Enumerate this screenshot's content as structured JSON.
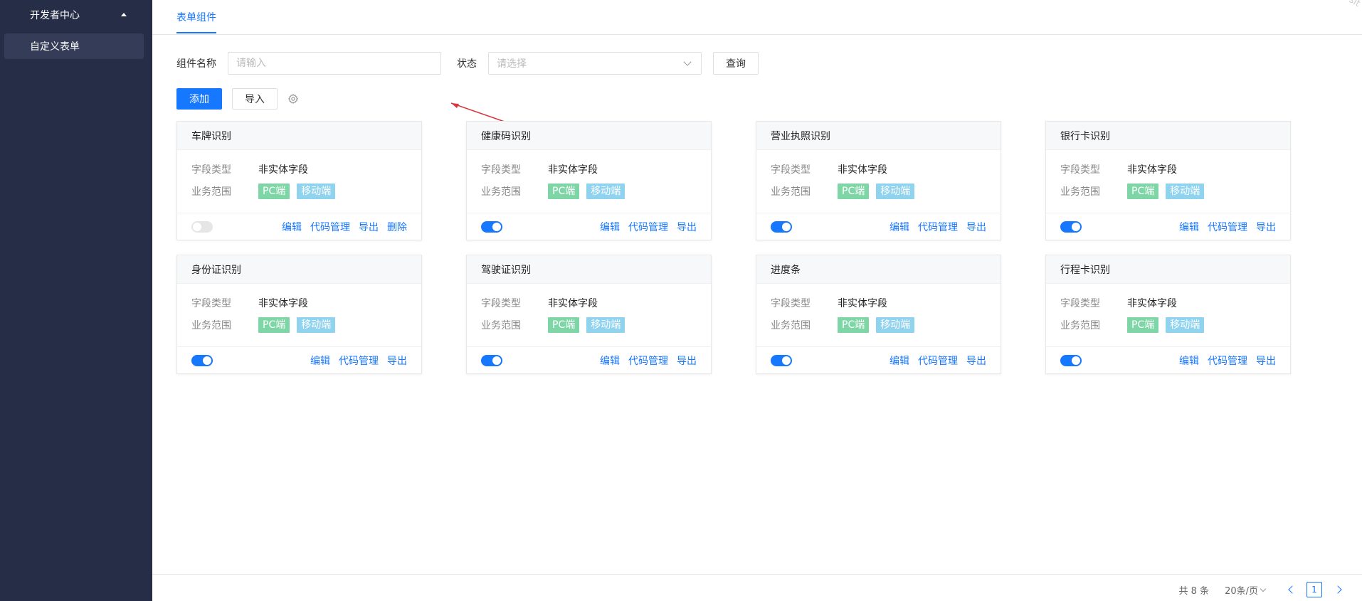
{
  "sidebar": {
    "section_title": "开发者中心",
    "items": [
      {
        "label": "自定义表单"
      }
    ]
  },
  "header": {
    "tab_label": "表单组件",
    "watermark": "as-sit"
  },
  "filters": {
    "name_label": "组件名称",
    "name_placeholder": "请输入",
    "status_label": "状态",
    "status_placeholder": "请选择",
    "query_label": "查询"
  },
  "toolbar": {
    "add_label": "添加",
    "import_label": "导入",
    "settings_icon": "gear-icon"
  },
  "card_labels": {
    "field_type": "字段类型",
    "scope": "业务范围"
  },
  "cards": [
    {
      "title": "车牌识别",
      "field_type": "非实体字段",
      "tags": [
        "PC端",
        "移动端"
      ],
      "enabled": false,
      "actions": [
        "编辑",
        "代码管理",
        "导出",
        "删除"
      ]
    },
    {
      "title": "健康码识别",
      "field_type": "非实体字段",
      "tags": [
        "PC端",
        "移动端"
      ],
      "enabled": true,
      "actions": [
        "编辑",
        "代码管理",
        "导出"
      ]
    },
    {
      "title": "营业执照识别",
      "field_type": "非实体字段",
      "tags": [
        "PC端",
        "移动端"
      ],
      "enabled": true,
      "actions": [
        "编辑",
        "代码管理",
        "导出"
      ]
    },
    {
      "title": "银行卡识别",
      "field_type": "非实体字段",
      "tags": [
        "PC端",
        "移动端"
      ],
      "enabled": true,
      "actions": [
        "编辑",
        "代码管理",
        "导出"
      ]
    },
    {
      "title": "身份证识别",
      "field_type": "非实体字段",
      "tags": [
        "PC端",
        "移动端"
      ],
      "enabled": true,
      "actions": [
        "编辑",
        "代码管理",
        "导出"
      ]
    },
    {
      "title": "驾驶证识别",
      "field_type": "非实体字段",
      "tags": [
        "PC端",
        "移动端"
      ],
      "enabled": true,
      "actions": [
        "编辑",
        "代码管理",
        "导出"
      ]
    },
    {
      "title": "进度条",
      "field_type": "非实体字段",
      "tags": [
        "PC端",
        "移动端"
      ],
      "enabled": true,
      "actions": [
        "编辑",
        "代码管理",
        "导出"
      ]
    },
    {
      "title": "行程卡识别",
      "field_type": "非实体字段",
      "tags": [
        "PC端",
        "移动端"
      ],
      "enabled": true,
      "actions": [
        "编辑",
        "代码管理",
        "导出"
      ]
    }
  ],
  "pagination": {
    "total_text": "共 8 条",
    "page_size_text": "20条/页",
    "current_page": "1"
  },
  "colors": {
    "primary": "#1677ff",
    "sidebar_bg": "#262d47",
    "tag_pc": "#7ed6a6",
    "tag_mobile": "#8fd3ef",
    "annotation_arrow": "#d9363e"
  }
}
